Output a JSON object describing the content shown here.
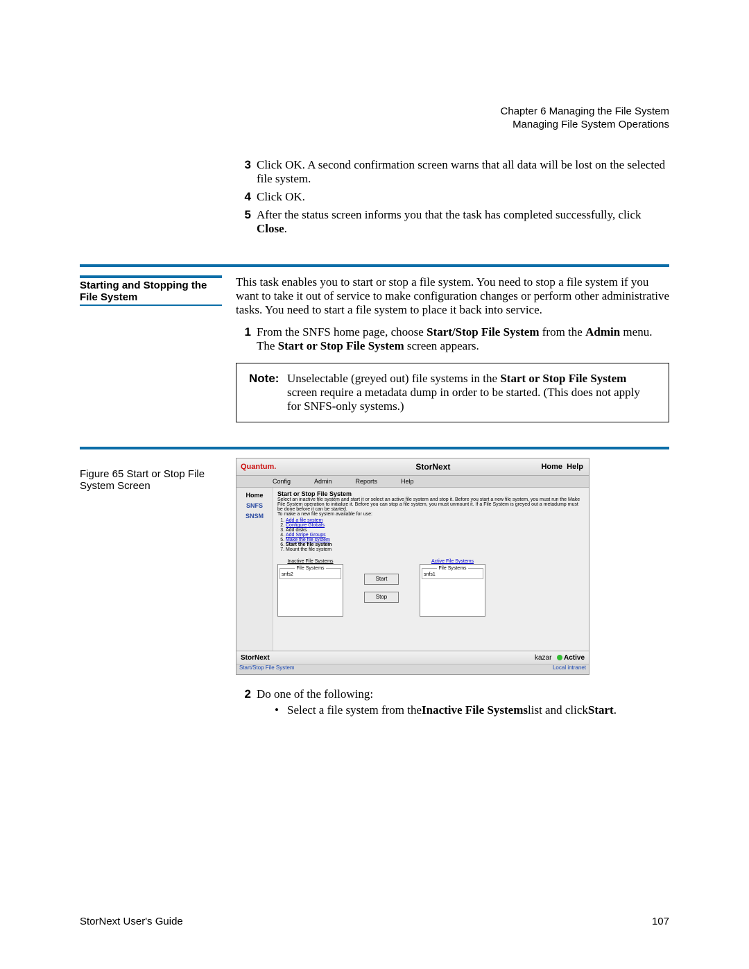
{
  "header": {
    "l1": "Chapter 6  Managing the File System",
    "l2": "Managing File System Operations"
  },
  "steps_a": {
    "items": [
      {
        "n": "3",
        "t_before": "Click OK. A second confirmation screen warns that all data will be lost on the selected file system."
      },
      {
        "n": "4",
        "t_before": "Click OK."
      },
      {
        "n": "5",
        "t_before": "After the status screen informs you that the task has completed successfully, click ",
        "bold": "Close",
        "t_after": "."
      }
    ]
  },
  "section": {
    "heading": "Starting and Stopping the File System",
    "intro": "This task enables you to start or stop a file system. You need to stop a file system if you want to take it out of service to make configuration changes or perform other administrative tasks. You need to start a file system to place it back into service.",
    "step1": {
      "n": "1",
      "pre": "From the SNFS home page, choose ",
      "b1": "Start/Stop File System",
      "mid": " from the ",
      "b2": "Admin",
      "mid2": " menu. The ",
      "b3": "Start or Stop File System",
      "post": " screen appears."
    }
  },
  "note": {
    "label": "Note:",
    "pre": "Unselectable (greyed out) file systems in the ",
    "b1": "Start or Stop File System",
    "post": " screen require a metadata dump in order to be started. (This does not apply for SNFS-only systems.)"
  },
  "figure": {
    "caption": "Figure 65  Start or Stop File System Screen"
  },
  "shot": {
    "brand": "Quantum.",
    "title": "StorNext",
    "home": "Home",
    "help": "Help",
    "menus": [
      "Config",
      "Admin",
      "Reports",
      "Help"
    ],
    "nav": {
      "home": "Home",
      "snfs": "SNFS",
      "snsm": "SNSM"
    },
    "panel": {
      "title": "Start or Stop File System",
      "desc": "Select an inactive file system and start it or select an active file system and stop it. Before you start a new file system, you must run the Make File System operation to initialize it. Before you can stop a file system, you must unmount it. If a File System is greyed out a metadump must be done before it can be started.",
      "leadin": "To make a new file system available for use:",
      "ol": [
        "Add a file system",
        "Configure Globals",
        "Add disks",
        "Add Stripe Groups",
        "Make the file system",
        "Start the file system",
        "Mount the file system"
      ],
      "links": [
        true,
        true,
        false,
        true,
        true,
        false,
        false
      ],
      "inactive_lbl": "Inactive File Systems",
      "active_lbl": "Active File Systems",
      "legend": "File Systems",
      "inactive_item": "snfs2",
      "active_item": "snfs1",
      "start": "Start",
      "stop": "Stop"
    },
    "status": {
      "sn": "StorNext",
      "host": "kazar",
      "state": "Active"
    },
    "taskbar": {
      "left": "Start/Stop File System",
      "right": "Local intranet"
    }
  },
  "steps_b": {
    "n": "2",
    "lead": "Do one of the following:",
    "bullet_pre": "Select a file system from the ",
    "bullet_b": "Inactive File Systems",
    "bullet_mid": " list and click ",
    "bullet_b2": "Start",
    "bullet_post": "."
  },
  "footer": {
    "guide": "StorNext User's Guide",
    "page": "107"
  }
}
